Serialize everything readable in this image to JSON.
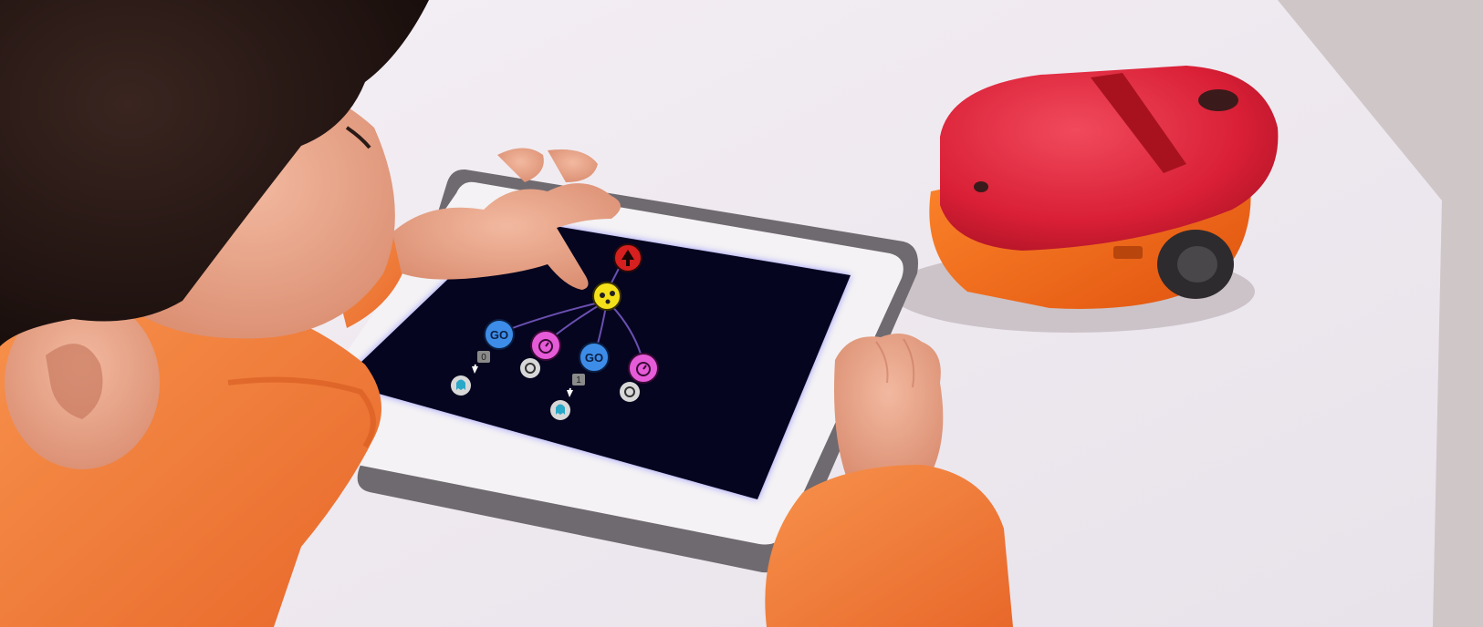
{
  "scene": {
    "description_free": true,
    "colors": {
      "wall": "#d9cfcf",
      "table": "#efe9ef",
      "tablet_frame": "#f4f2f4",
      "tablet_case": "#6f6a70",
      "screen": "#05051f",
      "hoodie": "#f07a32",
      "hair": "#2a1a16",
      "skin": "#e8a58a",
      "robot_top": "#e0283e",
      "robot_body": "#f06a1a"
    }
  },
  "program": {
    "connector_color": "#6a4fb0",
    "nodes": [
      {
        "name": "start-node",
        "icon": "up-arrow-icon",
        "color": "#d61f1f"
      },
      {
        "name": "sensor-node",
        "icon": "sensor-icon",
        "color": "#f4e11a"
      },
      {
        "name": "go-node-1",
        "icon": "go-icon",
        "label": "GO",
        "color": "#3d8de8"
      },
      {
        "name": "timer-node-1",
        "icon": "timer-icon",
        "color": "#e65bd8"
      },
      {
        "name": "go-node-2",
        "icon": "go-icon",
        "label": "GO",
        "color": "#3d8de8"
      },
      {
        "name": "timer-node-2",
        "icon": "timer-icon",
        "color": "#e65bd8"
      }
    ],
    "badges": [
      {
        "name": "value-badge-1",
        "text": "0"
      },
      {
        "name": "value-badge-2",
        "text": "1"
      }
    ],
    "leaves": [
      {
        "name": "end-node-1",
        "icon": "ghost-icon"
      },
      {
        "name": "loop-node-1",
        "icon": "repeat-icon"
      },
      {
        "name": "end-node-2",
        "icon": "ghost-icon"
      },
      {
        "name": "loop-node-2",
        "icon": "repeat-icon"
      }
    ]
  }
}
